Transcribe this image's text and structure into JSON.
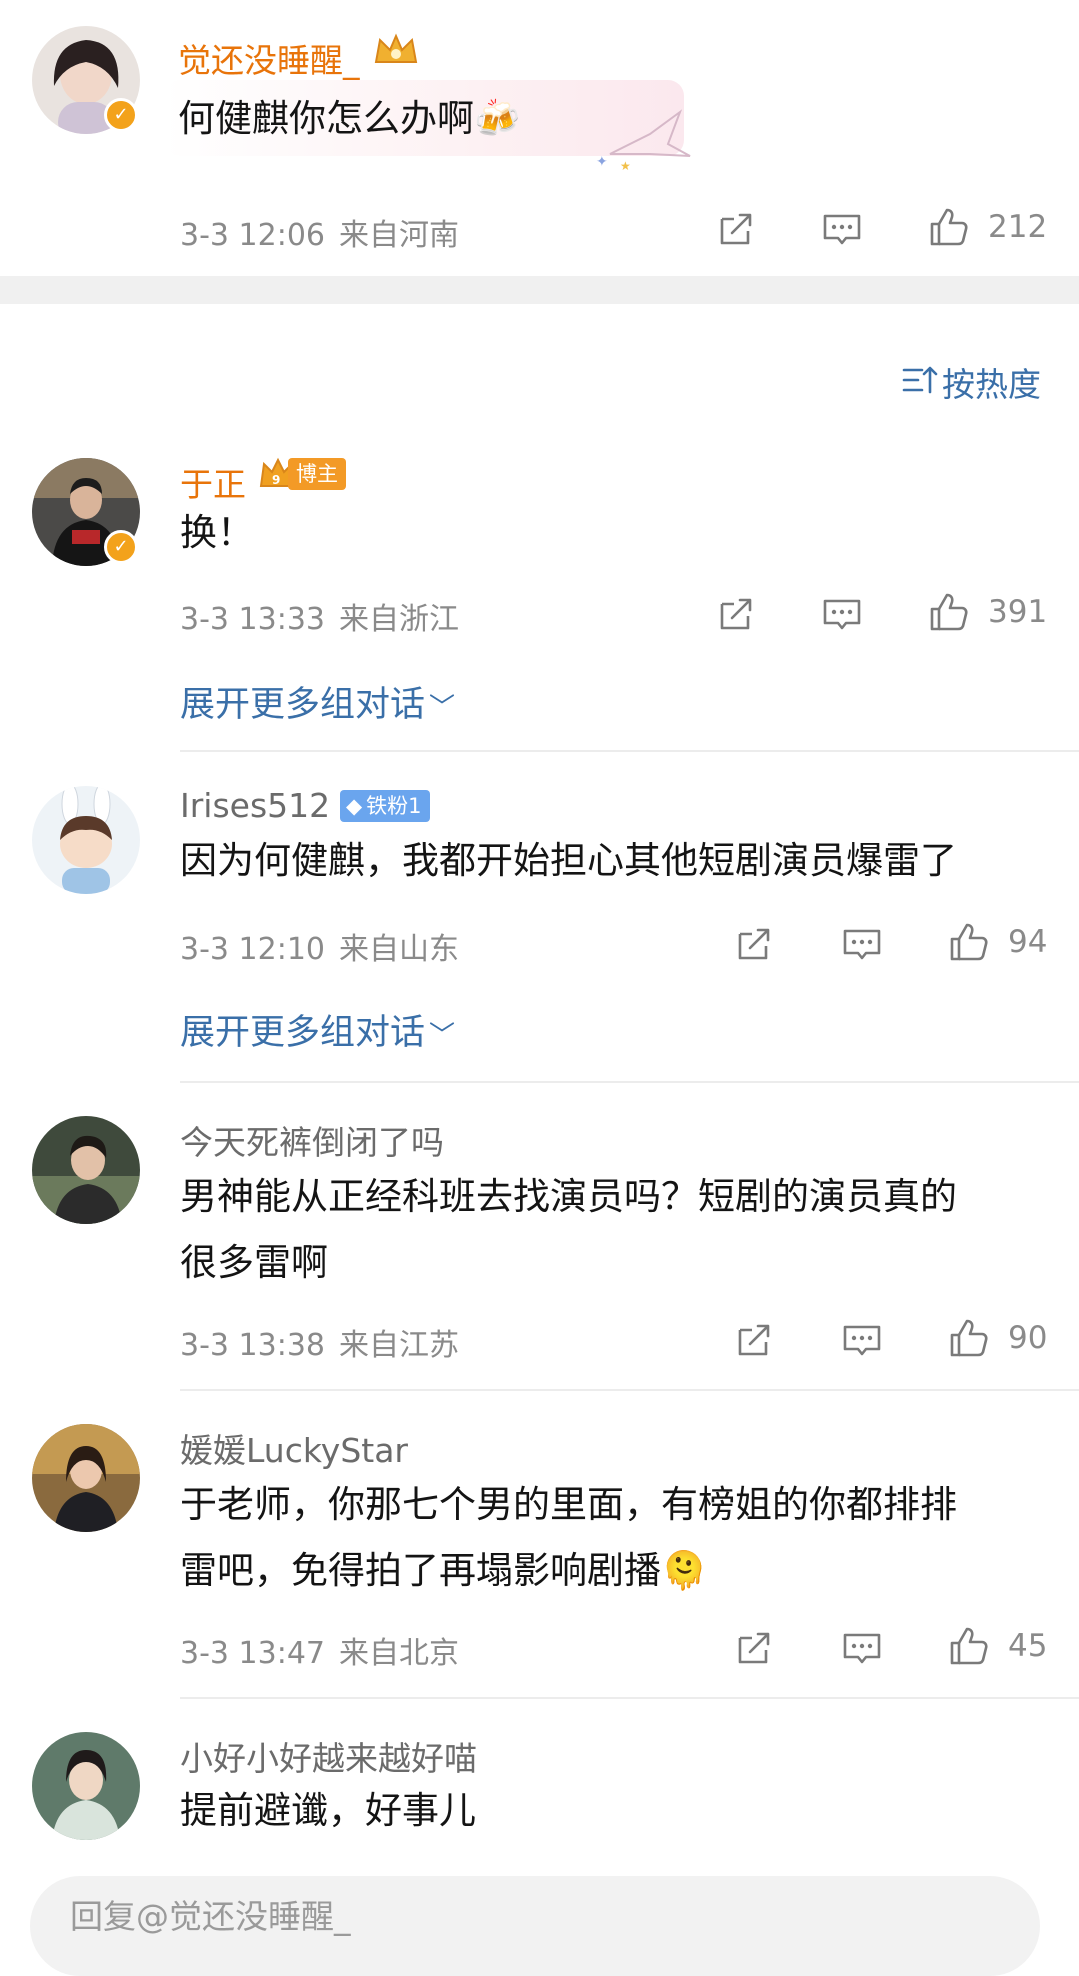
{
  "top_comment": {
    "name": "觉还没睡醒_",
    "text": "何健麒你怎么办啊🍻",
    "time": "3-3 12:06",
    "location": "来自河南",
    "likes": "212"
  },
  "sort": {
    "label": "按热度"
  },
  "comments": [
    {
      "name": "于正",
      "badge": "博主",
      "text_lines": [
        "换！"
      ],
      "time": "3-3 13:33",
      "location": "来自浙江",
      "likes": "391",
      "expand": "展开更多组对话"
    },
    {
      "name": "Irises512",
      "badge": "铁粉1",
      "text_lines": [
        "因为何健麒，我都开始担心其他短剧演员爆雷了"
      ],
      "time": "3-3 12:10",
      "location": "来自山东",
      "likes": "94",
      "expand": "展开更多组对话"
    },
    {
      "name": "今天死裤倒闭了吗",
      "text_lines": [
        "男神能从正经科班去找演员吗？短剧的演员真的",
        "很多雷啊"
      ],
      "time": "3-3 13:38",
      "location": "来自江苏",
      "likes": "90"
    },
    {
      "name": "媛媛LuckyStar",
      "text_lines": [
        "于老师，你那七个男的里面，有榜姐的你都排排",
        "雷吧，免得拍了再塌影响剧播🫠"
      ],
      "time": "3-3 13:47",
      "location": "来自北京",
      "likes": "45"
    },
    {
      "name": "小好小好越来越好喵",
      "text_lines": [
        "提前避谶，好事儿"
      ]
    }
  ],
  "reply_bar": {
    "placeholder": "回复@觉还没睡醒_"
  },
  "icons": {
    "share": "share-icon",
    "comment": "comment-icon",
    "like": "thumbs-up-icon",
    "sort": "sort-icon",
    "chevron": "chevron-down-icon"
  },
  "colors": {
    "name_orange": "#e8740a",
    "link_blue": "#3a6fa8",
    "meta_gray": "#8a8a8a"
  }
}
